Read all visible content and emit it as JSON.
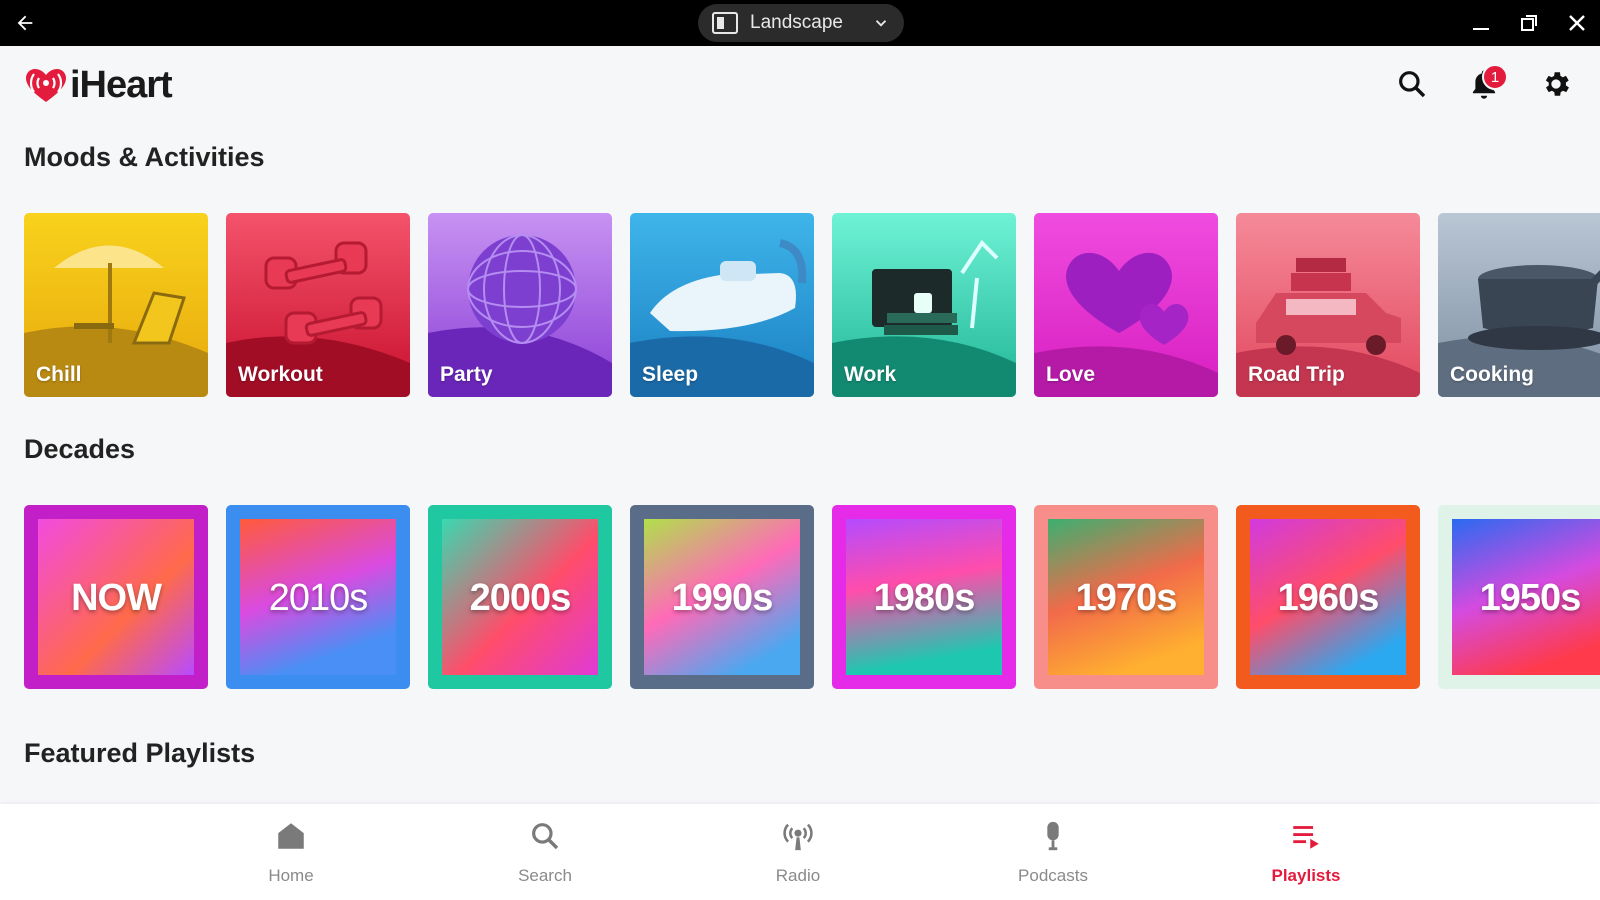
{
  "titlebar": {
    "orientation_label": "Landscape"
  },
  "brand": {
    "name": "iHeart",
    "accent": "#e31c3d"
  },
  "header": {
    "notification_count": "1"
  },
  "moods": {
    "title": "Moods & Activities",
    "items": [
      {
        "label": "Chill"
      },
      {
        "label": "Workout"
      },
      {
        "label": "Party"
      },
      {
        "label": "Sleep"
      },
      {
        "label": "Work"
      },
      {
        "label": "Love"
      },
      {
        "label": "Road Trip"
      },
      {
        "label": "Cooking"
      }
    ]
  },
  "decades": {
    "title": "Decades",
    "items": [
      {
        "label": "NOW"
      },
      {
        "label": "2010s"
      },
      {
        "label": "2000s"
      },
      {
        "label": "1990s"
      },
      {
        "label": "1980s"
      },
      {
        "label": "1970s"
      },
      {
        "label": "1960s"
      },
      {
        "label": "1950s"
      }
    ]
  },
  "featured": {
    "title": "Featured Playlists"
  },
  "nav": {
    "items": [
      {
        "label": "Home",
        "icon": "home-icon"
      },
      {
        "label": "Search",
        "icon": "search-icon"
      },
      {
        "label": "Radio",
        "icon": "radio-icon"
      },
      {
        "label": "Podcasts",
        "icon": "microphone-icon"
      },
      {
        "label": "Playlists",
        "icon": "playlist-icon"
      }
    ],
    "active": "Playlists"
  }
}
